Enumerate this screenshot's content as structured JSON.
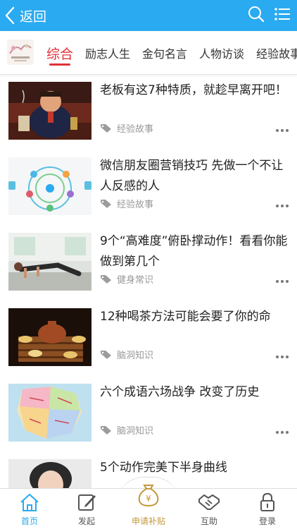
{
  "topbar": {
    "back_label": "返回",
    "icons": [
      "chevron-left-icon",
      "search-icon",
      "menu-list-icon"
    ]
  },
  "tabs": [
    "综合",
    "励志人生",
    "金句名言",
    "人物访谈",
    "经验故事"
  ],
  "active_tab": "综合",
  "articles": [
    {
      "title": "老板有这7种特质，就趁早离开吧！",
      "category": "经验故事"
    },
    {
      "title": "微信朋友圈营销技巧 先做一个不让人反感的人",
      "category": "经验故事"
    },
    {
      "title": "9个“高难度”俯卧撑动作！看看你能做到第几个",
      "category": "健身常识"
    },
    {
      "title": "12种喝茶方法可能会要了你的命",
      "category": "脑洞知识"
    },
    {
      "title": "六个成语六场战争 改变了历史",
      "category": "脑洞知识"
    },
    {
      "title": "5个动作完美下半身曲线",
      "category": ""
    }
  ],
  "bottom_nav": {
    "home": "首页",
    "post": "发起",
    "subsidy": "申请补贴",
    "mutual": "互助",
    "login": "登录"
  },
  "colors": {
    "topbar": "#2aaaf0",
    "active_tab": "#e0323b",
    "nav_active": "#2aaaf0",
    "subsidy_gold": "#c39a3a"
  }
}
